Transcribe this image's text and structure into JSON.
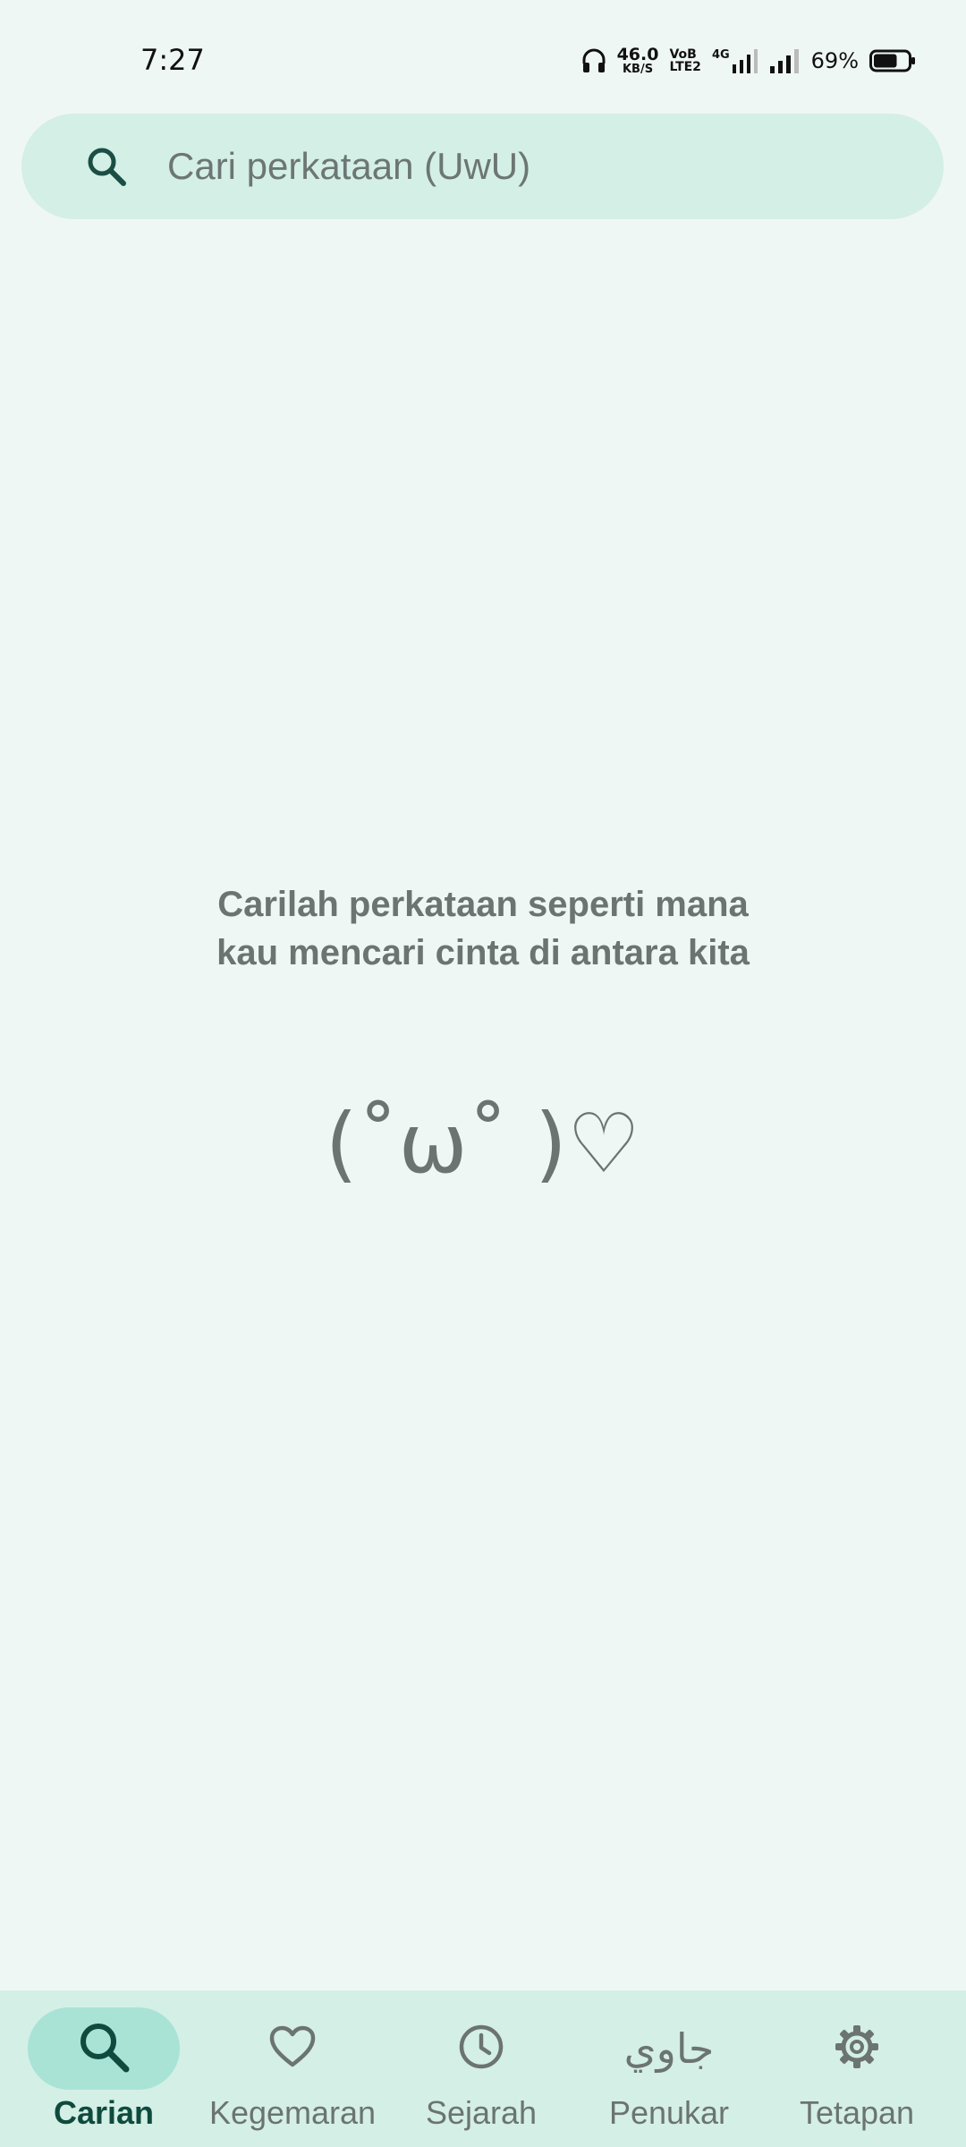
{
  "status_bar": {
    "time": "7:27",
    "net_speed_value": "46.0",
    "net_speed_unit": "KB/S",
    "volte_top": "VoB",
    "volte_bottom": "LTE2",
    "network_type": "4G",
    "battery_percent": "69%",
    "battery_level": 0.69,
    "icons": [
      "headphones-icon",
      "signal-icon",
      "battery-icon"
    ]
  },
  "search": {
    "placeholder": "Cari perkataan (UwU)",
    "value": "",
    "icon": "search-icon"
  },
  "empty_state": {
    "line1": "Carilah perkataan seperti mana",
    "line2": "kau mencari cinta di antara kita",
    "kaomoji": "(˚ω˚ )♡"
  },
  "bottom_nav": {
    "items": [
      {
        "label": "Carian",
        "icon": "search-icon",
        "active": true
      },
      {
        "label": "Kegemaran",
        "icon": "heart-icon",
        "active": false
      },
      {
        "label": "Sejarah",
        "icon": "clock-icon",
        "active": false
      },
      {
        "label": "Penukar",
        "icon": "jawi-icon",
        "glyph": "جاوي",
        "active": false
      },
      {
        "label": "Tetapan",
        "icon": "gear-icon",
        "active": false
      }
    ]
  },
  "colors": {
    "background": "#eff7f5",
    "surface": "#d4efe5",
    "active_pill": "#a8e3d6",
    "active_text": "#0f4a3e",
    "muted_text": "#6b7471"
  }
}
